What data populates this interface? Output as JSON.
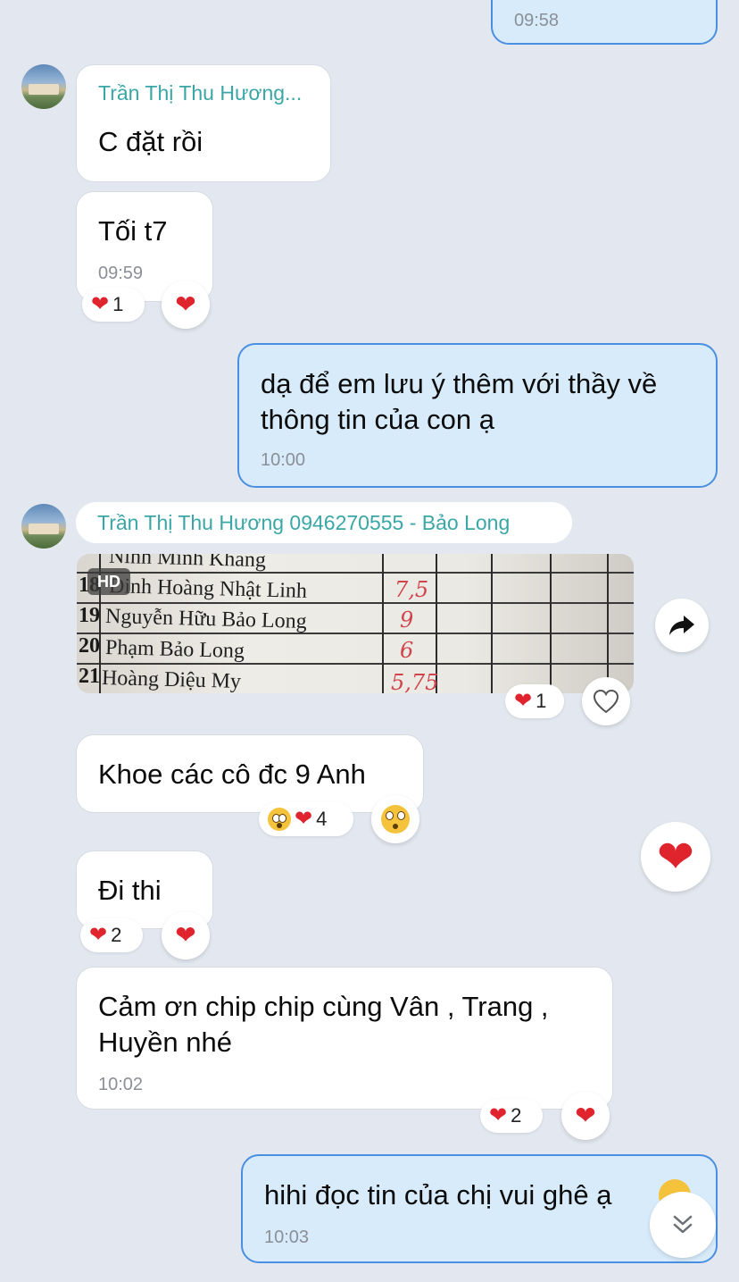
{
  "messages": {
    "m0_time": "09:58",
    "group1": {
      "sender": "Trần Thị Thu Hương...",
      "msg1_text": "C đặt rồi",
      "msg2_text": "Tối t7",
      "msg2_time": "09:59",
      "msg2_reaction_count": "1"
    },
    "me1": {
      "text": "dạ để em lưu ý thêm với thầy về thông tin của con ạ",
      "time": "10:00"
    },
    "group2": {
      "sender": "Trần Thị Thu Hương 0946270555 - Bảo Long",
      "photo": {
        "hd_label": "HD",
        "rows": [
          {
            "num": "",
            "name": "Ninh Minh Khang",
            "score": ""
          },
          {
            "num": "18",
            "name": "Đinh Hoàng Nhật Linh",
            "score": "7,5"
          },
          {
            "num": "19",
            "name": "Nguyễn Hữu Bảo Long",
            "score": "9"
          },
          {
            "num": "20",
            "name": "Phạm Bảo Long",
            "score": "6"
          },
          {
            "num": "21",
            "name": "Hoàng Diệu My",
            "score": "5,75"
          }
        ],
        "reaction_count": "1"
      },
      "msg3_text": "Khoe các cô đc 9 Anh",
      "msg3_reaction_count": "4",
      "msg4_text": "Đi thi",
      "msg4_reaction_count": "2",
      "msg5_text": "Cảm ơn chip chip cùng Vân , Trang ,\nHuyền nhé",
      "msg5_time": "10:02",
      "msg5_reaction_count": "2"
    },
    "me2": {
      "text": "hihi đọc tin của chị vui ghê ạ",
      "time": "10:03"
    }
  },
  "icons": {
    "heart": "heart-icon",
    "like_outline": "heart-outline-icon",
    "forward": "forward-icon",
    "scroll_down": "chevron-double-down-icon",
    "shocked": "flushed-face-icon",
    "smile": "smiling-face-icon"
  },
  "colors": {
    "background": "#e3e8f0",
    "sent_bubble": "#d7ebfb",
    "sent_border": "#4a8fe0",
    "sender_name": "#3aa6a6",
    "heart": "#e0242e"
  }
}
